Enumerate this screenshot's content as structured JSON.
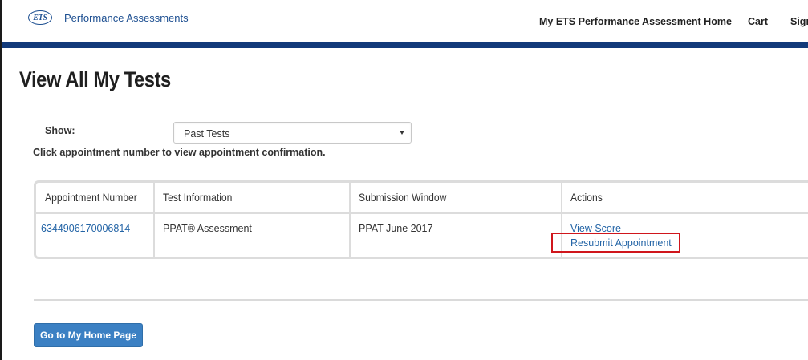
{
  "header": {
    "logo_text": "ETS",
    "brand": "Performance Assessments",
    "nav": {
      "home": "My ETS Performance Assessment Home",
      "cart": "Cart",
      "sign": "Sign"
    }
  },
  "page": {
    "title": "View All My Tests"
  },
  "filter": {
    "show_label": "Show:",
    "selected": "Past Tests",
    "instruction": "Click appointment number to view appointment confirmation."
  },
  "table": {
    "headers": [
      "Appointment Number",
      "Test Information",
      "Submission Window",
      "Actions"
    ],
    "rows": [
      {
        "appointment_number": "6344906170006814",
        "test_information": "PPAT® Assessment",
        "submission_window": "PPAT June 2017",
        "actions": [
          "View Score",
          "Resubmit Appointment"
        ]
      }
    ]
  },
  "footer": {
    "home_button": "Go to My Home Page"
  },
  "colors": {
    "brand_blue": "#1d4f91",
    "nav_rule": "#123a7a",
    "link": "#2364a6",
    "button": "#3b80c3",
    "highlight": "#d0161c"
  }
}
